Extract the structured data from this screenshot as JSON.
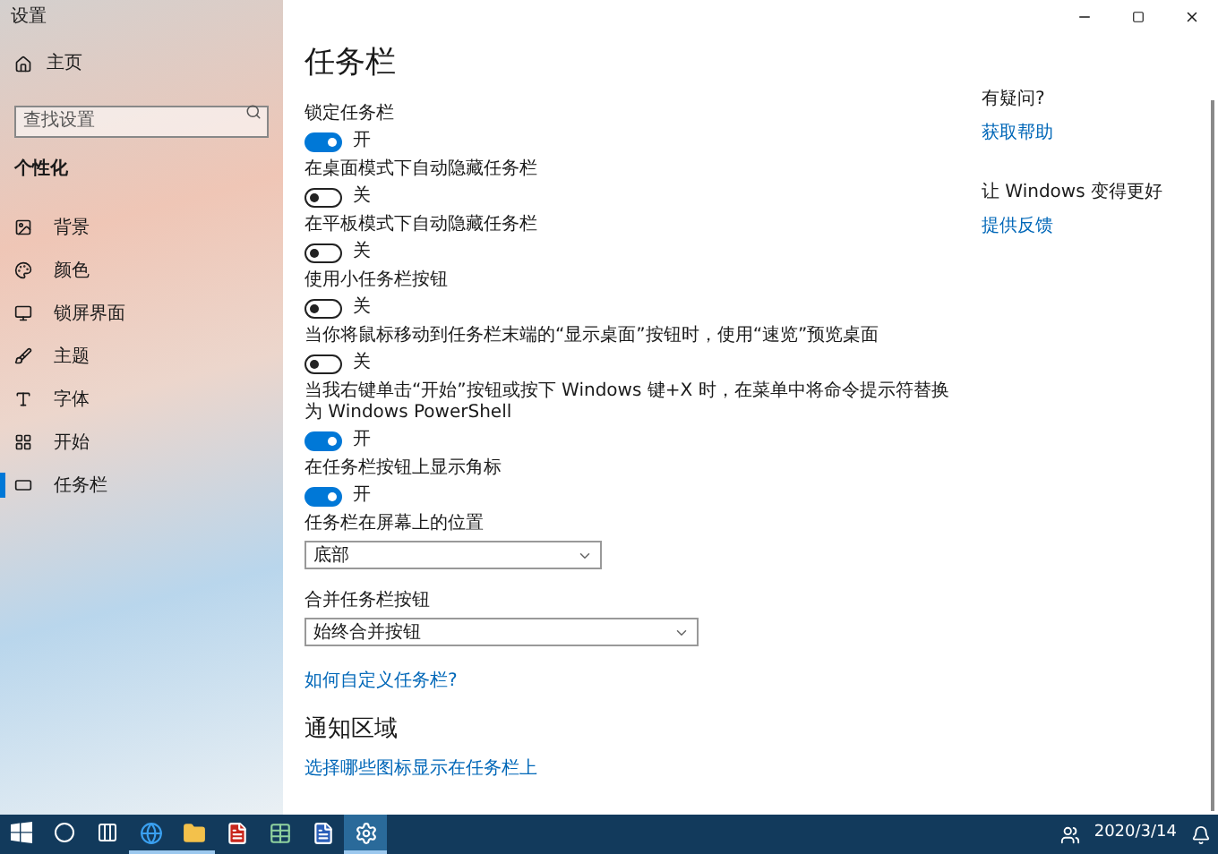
{
  "window": {
    "title": "设置"
  },
  "sidebar": {
    "home": "主页",
    "search": {
      "placeholder": "查找设置"
    },
    "section": "个性化",
    "items": [
      {
        "label": "背景",
        "selected": false
      },
      {
        "label": "颜色",
        "selected": false
      },
      {
        "label": "锁屏界面",
        "selected": false
      },
      {
        "label": "主题",
        "selected": false
      },
      {
        "label": "字体",
        "selected": false
      },
      {
        "label": "开始",
        "selected": false
      },
      {
        "label": "任务栏",
        "selected": true
      }
    ]
  },
  "page": {
    "title": "任务栏",
    "settings": [
      {
        "kind": "toggle",
        "label": "锁定任务栏",
        "on": true,
        "state_text": "开"
      },
      {
        "kind": "toggle",
        "label": "在桌面模式下自动隐藏任务栏",
        "on": false,
        "state_text": "关"
      },
      {
        "kind": "toggle",
        "label": "在平板模式下自动隐藏任务栏",
        "on": false,
        "state_text": "关"
      },
      {
        "kind": "toggle",
        "label": "使用小任务栏按钮",
        "on": false,
        "state_text": "关"
      },
      {
        "kind": "toggle",
        "label": "当你将鼠标移动到任务栏末端的“显示桌面”按钮时，使用“速览”预览桌面",
        "on": false,
        "state_text": "关"
      },
      {
        "kind": "toggle",
        "label": "当我右键单击“开始”按钮或按下 Windows 键+X 时，在菜单中将命令提示符替换为 Windows PowerShell",
        "on": true,
        "state_text": "开"
      },
      {
        "kind": "toggle",
        "label": "在任务栏按钮上显示角标",
        "on": true,
        "state_text": "开"
      },
      {
        "kind": "dropdown",
        "label": "任务栏在屏幕上的位置",
        "value": "底部"
      },
      {
        "kind": "dropdown",
        "label": "合并任务栏按钮",
        "value": "始终合并按钮"
      }
    ],
    "link": "如何自定义任务栏?",
    "section": "通知区域",
    "section_link": "选择哪些图标显示在任务栏上"
  },
  "aside": [
    {
      "heading": "有疑问?",
      "link": "获取帮助"
    },
    {
      "heading": "让 Windows 变得更好",
      "link": "提供反馈"
    }
  ],
  "taskbar": {
    "apps": [
      {
        "selected": false,
        "running": false
      },
      {
        "selected": false,
        "running": false
      },
      {
        "selected": false,
        "running": false
      },
      {
        "selected": false,
        "running": true
      },
      {
        "selected": false,
        "running": true
      },
      {
        "selected": false,
        "running": false
      },
      {
        "selected": false,
        "running": false
      },
      {
        "selected": false,
        "running": false
      },
      {
        "selected": true,
        "running": true
      }
    ],
    "date": "2020/3/14"
  }
}
